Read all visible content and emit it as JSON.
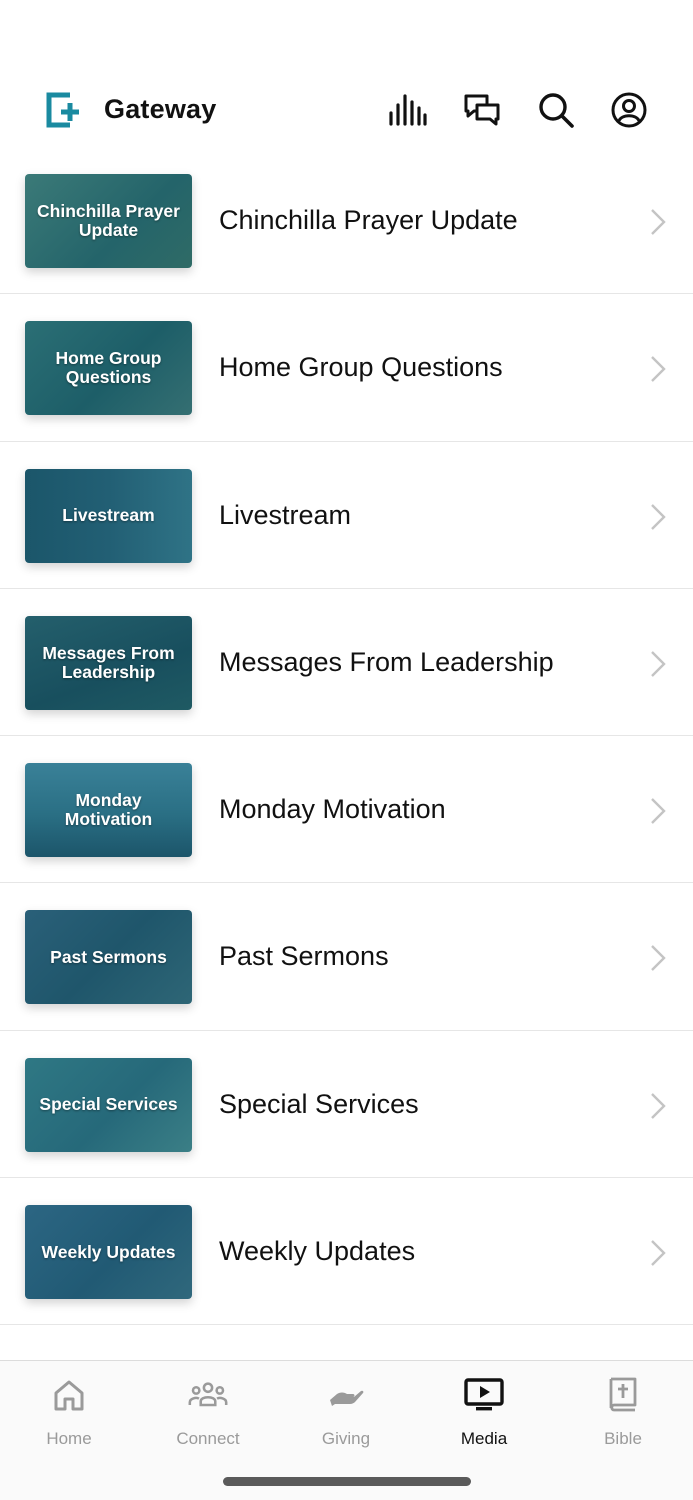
{
  "app": {
    "brand": "Gateway",
    "accent": "#1a8aa0",
    "header_icons": [
      "audio-bars-icon",
      "chat-icon",
      "search-icon",
      "account-icon"
    ]
  },
  "media_list": [
    {
      "title": "Chinchilla Prayer Update",
      "thumb_text": "Chinchilla Prayer Update",
      "thumb_color": "#2f6c70"
    },
    {
      "title": "Home Group Questions",
      "thumb_text": "Home Group Questions",
      "thumb_color": "#24666e"
    },
    {
      "title": "Livestream",
      "thumb_text": "Livestream",
      "thumb_color": "#1e5f72"
    },
    {
      "title": "Messages From Leadership",
      "thumb_text": "Messages From Leadership",
      "thumb_color": "#1d5a6a"
    },
    {
      "title": "Monday Motivation",
      "thumb_text": "Monday Motivation",
      "thumb_color": "#2a6f84"
    },
    {
      "title": "Past Sermons",
      "thumb_text": "Past Sermons",
      "thumb_color": "#245d72"
    },
    {
      "title": "Special Services",
      "thumb_text": "Special Services",
      "thumb_color": "#2b717a"
    },
    {
      "title": "Weekly Updates",
      "thumb_text": "Weekly Updates",
      "thumb_color": "#275f78"
    }
  ],
  "tabs": [
    {
      "label": "Home",
      "icon": "home-icon",
      "active": false
    },
    {
      "label": "Connect",
      "icon": "people-icon",
      "active": false
    },
    {
      "label": "Giving",
      "icon": "giving-hand-icon",
      "active": false
    },
    {
      "label": "Media",
      "icon": "tv-play-icon",
      "active": true
    },
    {
      "label": "Bible",
      "icon": "bible-icon",
      "active": false
    }
  ]
}
